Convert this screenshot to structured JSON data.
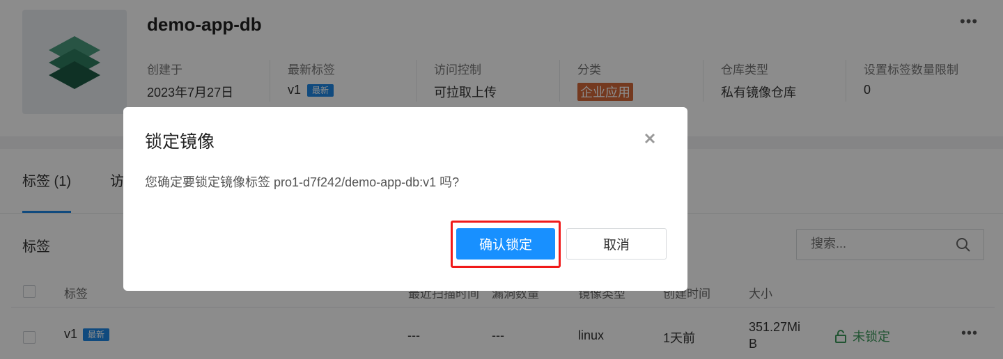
{
  "repo": {
    "name": "demo-app-db",
    "more_label": "•••",
    "meta": [
      {
        "key": "创建于",
        "value": "2023年7月27日"
      },
      {
        "key": "最新标签",
        "value": "v1",
        "badge": "最新"
      },
      {
        "key": "访问控制",
        "value": "可拉取上传"
      },
      {
        "key": "分类",
        "value": "企业应用"
      },
      {
        "key": "仓库类型",
        "value": "私有镜像仓库"
      },
      {
        "key": "设置标签数量限制",
        "value": "0"
      }
    ]
  },
  "tabs": [
    {
      "label": "标签 (1)",
      "active": true
    },
    {
      "label": "访"
    }
  ],
  "section": {
    "title": "标签",
    "search_placeholder": "搜索..."
  },
  "table": {
    "headers": [
      "标签",
      "最近扫描时间",
      "漏洞数量",
      "镜像类型",
      "创建时间",
      "大小"
    ],
    "rows": [
      {
        "tag": "v1",
        "badge": "最新",
        "scan_time": "---",
        "vulns": "---",
        "image_type": "linux",
        "created": "1天前",
        "size_line1": "351.27Mi",
        "size_line2": "B",
        "lock_status": "未锁定",
        "more": "•••"
      }
    ]
  },
  "modal": {
    "title": "锁定镜像",
    "message": "您确定要锁定镜像标签 pro1-d7f242/demo-app-db:v1 吗?",
    "confirm_label": "确认锁定",
    "cancel_label": "取消"
  },
  "colors": {
    "primary": "#1890ff",
    "highlight": "#f01a1a",
    "category_tag": "#d4693a",
    "unlocked": "#3d9a5c"
  }
}
